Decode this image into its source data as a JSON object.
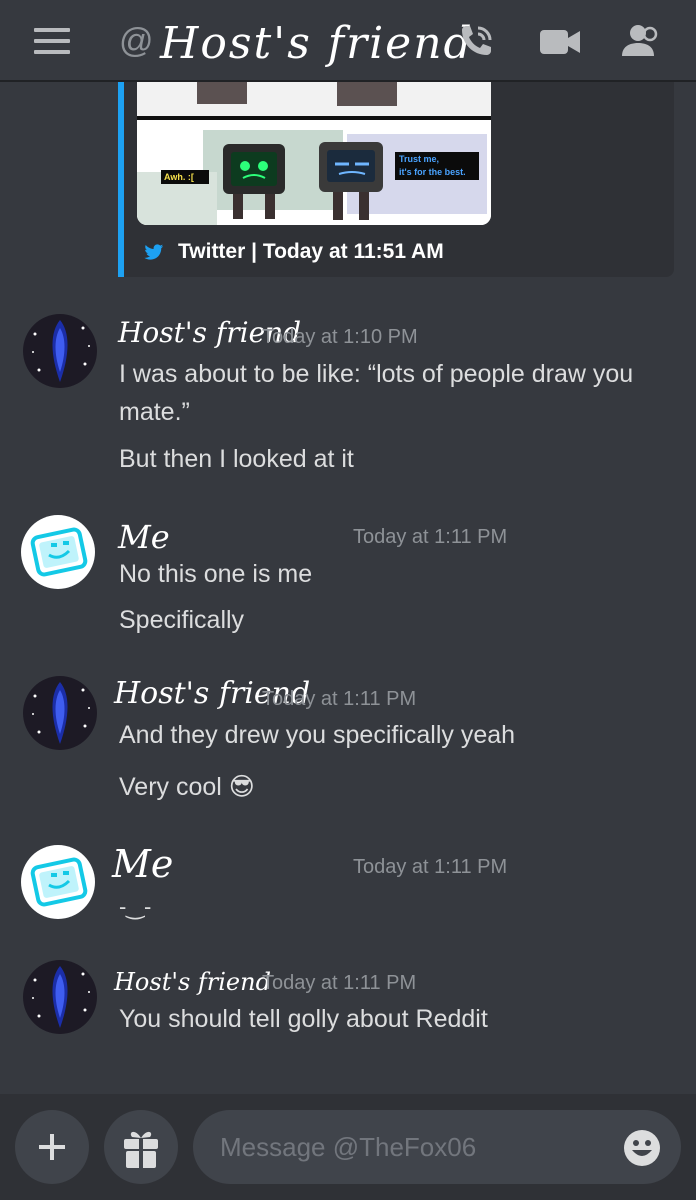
{
  "header": {
    "at_symbol": "@",
    "title": "Host's friend",
    "menu_icon": "hamburger-menu-icon",
    "call_icon": "phone-call-icon",
    "video_icon": "video-camera-icon",
    "members_icon": "members-icon"
  },
  "embed": {
    "provider_icon": "twitter-bird-icon",
    "footer": "Twitter | Today at 11:51 AM",
    "image_caption_left": "Awh. :[",
    "image_caption_right_line1": "Trust me,",
    "image_caption_right_line2": "it's for the best."
  },
  "messages": [
    {
      "author": "Host's friend",
      "timestamp": "Today at 1:10 PM",
      "lines": [
        "I was about to be like: “lots of people draw you mate.”",
        "But then I looked at it"
      ]
    },
    {
      "author": "Me",
      "timestamp": "Today at 1:11 PM",
      "lines": [
        "No this one is me",
        "Specifically"
      ]
    },
    {
      "author": "Host's friend",
      "timestamp": "Today at 1:11 PM",
      "lines": [
        "And they drew you specifically yeah",
        "Very cool 😎"
      ]
    },
    {
      "author": "Me",
      "timestamp": "Today at 1:11 PM",
      "lines": [
        "-‿-"
      ]
    },
    {
      "author": "Host's friend",
      "timestamp": "Today at 1:11 PM",
      "lines": [
        "You should tell golly about Reddit"
      ]
    }
  ],
  "composer": {
    "placeholder": "Message @TheFox06",
    "add_icon": "plus-icon",
    "gift_icon": "gift-icon",
    "emoji_icon": "emoji-smile-icon"
  },
  "colors": {
    "background": "#36393f",
    "embed_accent": "#1da1f2",
    "timestamp": "#8e9297",
    "message_text": "#dcddde"
  }
}
